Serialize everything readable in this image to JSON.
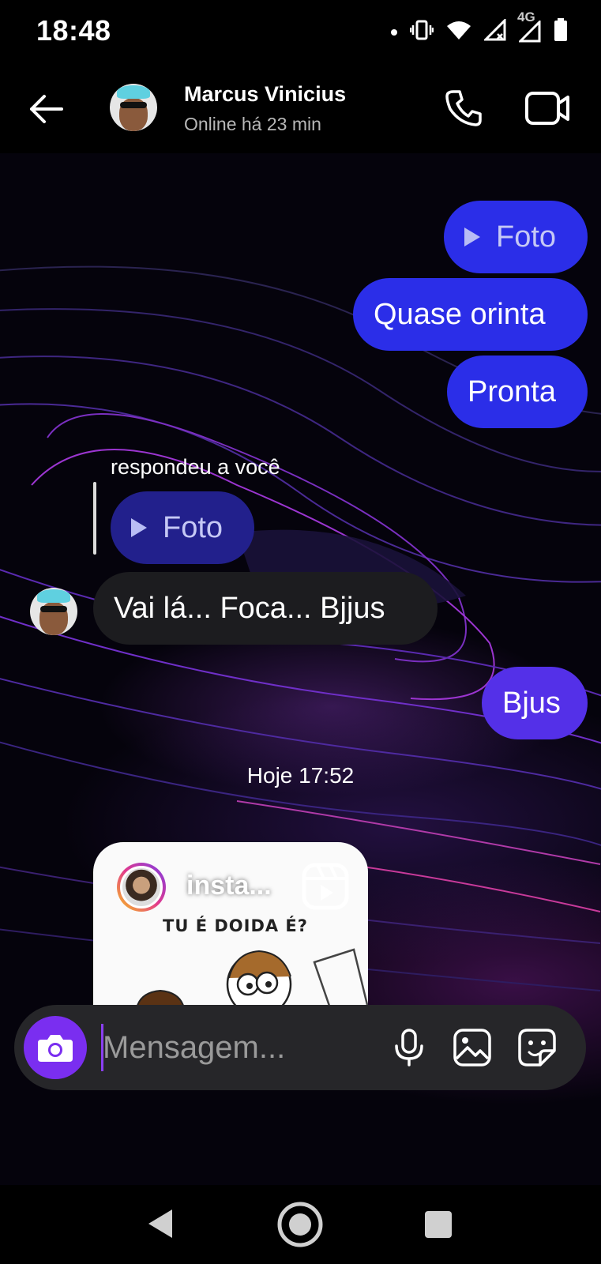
{
  "status_bar": {
    "time": "18:48",
    "network": "4G",
    "icons": [
      "notification-dot-icon",
      "vibrate-icon",
      "wifi-icon",
      "signal-no-service-icon",
      "signal-icon",
      "battery-icon"
    ]
  },
  "header": {
    "contact_name": "Marcus Vinicius",
    "contact_status": "Online há 23 min",
    "icons": [
      "back-arrow-icon",
      "phone-icon",
      "video-camera-icon"
    ]
  },
  "messages": [
    {
      "id": "m1",
      "direction": "outgoing",
      "type": "photo",
      "label": "Foto"
    },
    {
      "id": "m2",
      "direction": "outgoing",
      "type": "text",
      "text": "Quase orinta"
    },
    {
      "id": "m3",
      "direction": "outgoing",
      "type": "text",
      "text": "Pronta"
    },
    {
      "id": "m4",
      "direction": "incoming",
      "type": "text",
      "reply_label": "respondeu a você",
      "reply_to": "Foto",
      "text": "Vai lá... Foca... Bjjus"
    },
    {
      "id": "m5",
      "direction": "outgoing",
      "type": "text",
      "text": "Bjus"
    }
  ],
  "date_separator": "Hoje 17:52",
  "shared_post": {
    "username": "insta...",
    "caption": "TU É DOIDA É?",
    "icons": [
      "reels-icon"
    ]
  },
  "composer": {
    "placeholder": "Mensagem...",
    "value": "",
    "icons": [
      "camera-icon",
      "microphone-icon",
      "gallery-icon",
      "sticker-icon"
    ]
  },
  "colors": {
    "outgoing_bubble": "#2b2ee8",
    "outgoing_bubble_last": "#5430e8",
    "incoming_bubble": "#1c1c1f",
    "camera_button": "#7a2ef0"
  },
  "navbar": {
    "icons": [
      "nav-back-icon",
      "nav-home-icon",
      "nav-recents-icon"
    ]
  }
}
